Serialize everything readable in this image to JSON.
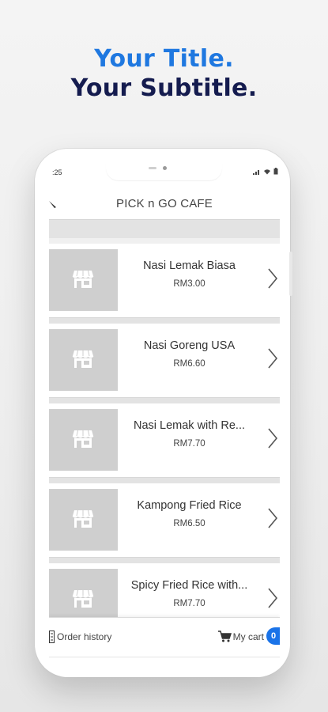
{
  "promo": {
    "title": "Your Title.",
    "subtitle": "Your Subtitle."
  },
  "status_bar": {
    "time": ":25"
  },
  "header": {
    "title": "PICK n GO CAFE",
    "back_icon": "back-arrow-icon"
  },
  "items": [
    {
      "name": "Nasi Lemak Biasa",
      "price": "RM3.00"
    },
    {
      "name": "Nasi Goreng USA",
      "price": "RM6.60"
    },
    {
      "name": "Nasi Lemak with Re...",
      "price": "RM7.70"
    },
    {
      "name": "Kampong Fried Rice",
      "price": "RM6.50"
    },
    {
      "name": "Spicy Fried Rice with...",
      "price": "RM7.70"
    }
  ],
  "bottom_nav": {
    "order_history": "Order history",
    "my_cart": "My cart",
    "cart_count": "0"
  },
  "colors": {
    "title": "#1f78e0",
    "subtitle": "#151c4f",
    "badge": "#1a73e8",
    "thumb": "#cfcfcf"
  }
}
